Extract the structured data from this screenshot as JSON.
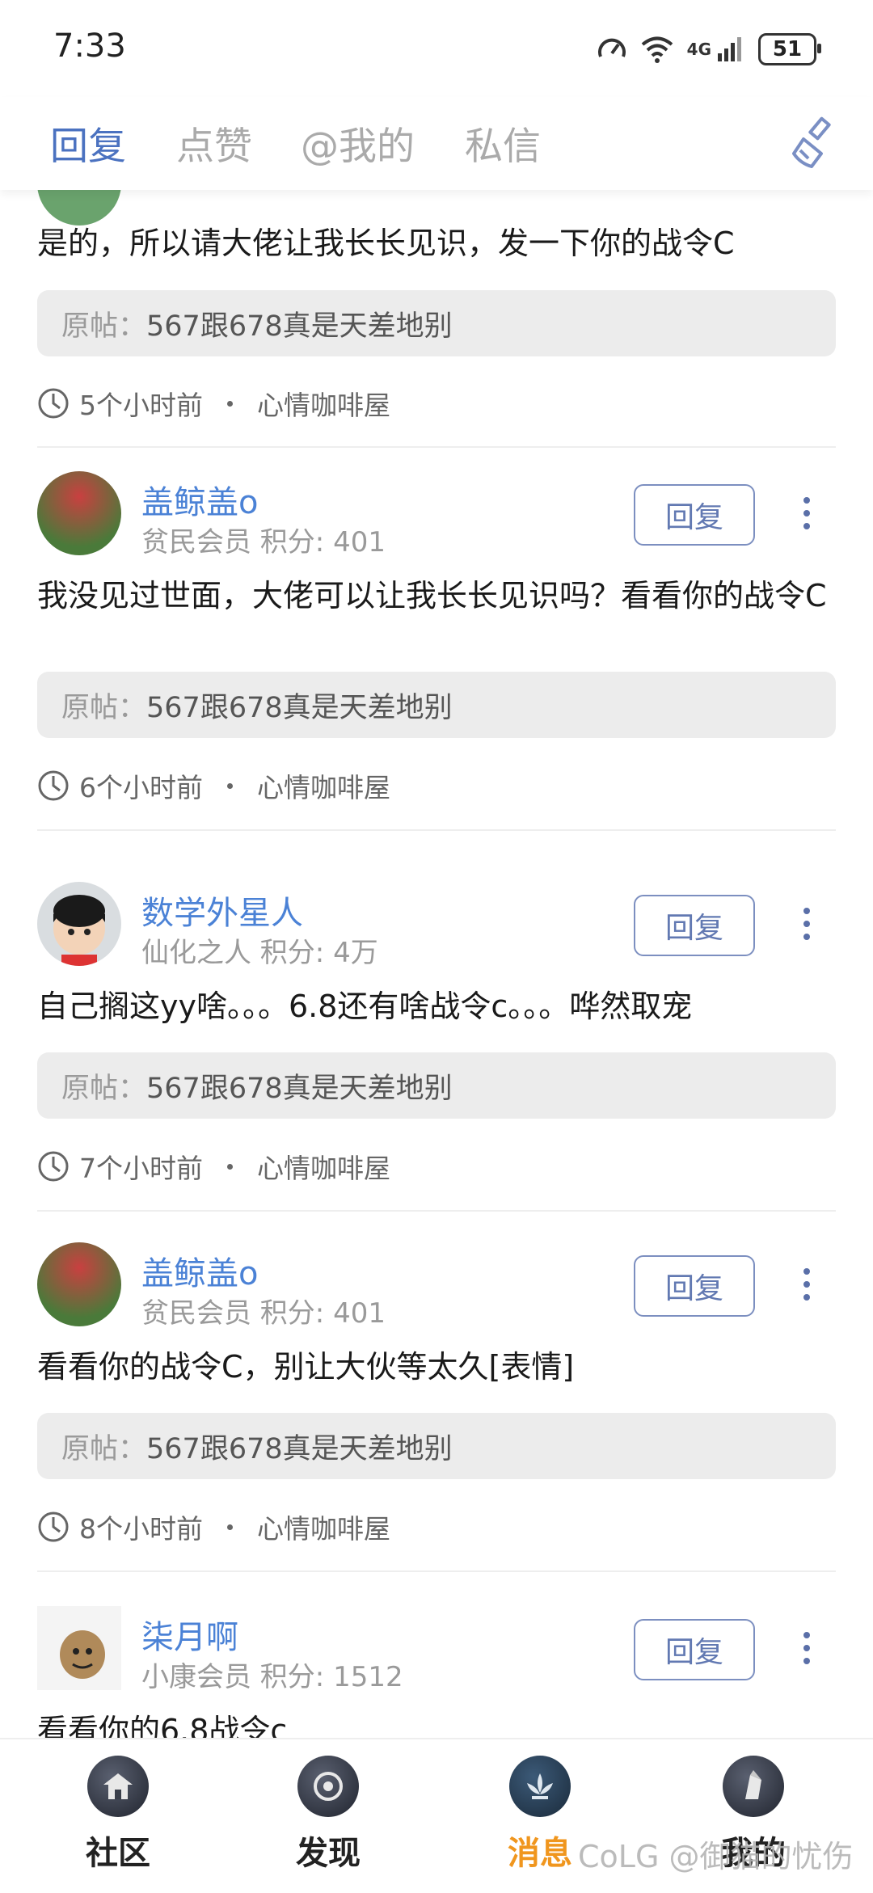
{
  "status_bar": {
    "time": "7:33",
    "network": "4G",
    "battery": "51"
  },
  "tabs": [
    {
      "label": "回复",
      "active": true
    },
    {
      "label": "点赞",
      "active": false
    },
    {
      "label": "@我的",
      "active": false
    },
    {
      "label": "私信",
      "active": false
    }
  ],
  "items": [
    {
      "content": "是的，所以请大佬让我长长见识，发一下你的战令C",
      "orig_label": "原帖：",
      "orig_text": "567跟678真是天差地别",
      "time": "5个小时前",
      "board": "心情咖啡屋"
    },
    {
      "username": "盖鲸盖o",
      "meta": "贫民会员 积分: 401",
      "reply_label": "回复",
      "content": "我没见过世面，大佬可以让我长长见识吗？看看你的战令C",
      "orig_label": "原帖：",
      "orig_text": "567跟678真是天差地别",
      "time": "6个小时前",
      "board": "心情咖啡屋"
    },
    {
      "username": "数学外星人",
      "meta": "仙化之人 积分: 4万",
      "reply_label": "回复",
      "content": "自己搁这yy啥。。。6.8还有啥战令c。。。哗然取宠",
      "orig_label": "原帖：",
      "orig_text": "567跟678真是天差地别",
      "time": "7个小时前",
      "board": "心情咖啡屋"
    },
    {
      "username": "盖鲸盖o",
      "meta": "贫民会员 积分: 401",
      "reply_label": "回复",
      "content": "看看你的战令C，别让大伙等太久[表情]",
      "orig_label": "原帖：",
      "orig_text": "567跟678真是天差地别",
      "time": "8个小时前",
      "board": "心情咖啡屋"
    },
    {
      "username": "柒月啊",
      "meta": "小康会员 积分: 1512",
      "reply_label": "回复",
      "content": "看看你的6.8战令c"
    }
  ],
  "bottom_nav": [
    {
      "label": "社区",
      "icon": "community-icon"
    },
    {
      "label": "发现",
      "icon": "discover-icon"
    },
    {
      "label": "消息",
      "icon": "message-icon",
      "active": true
    },
    {
      "label": "我的",
      "icon": "profile-icon"
    }
  ],
  "watermark": "CoLG @御猫的忧伤",
  "colors": {
    "accent": "#4b72c0",
    "username": "#4b82d6",
    "nav_active": "#f0961e"
  }
}
